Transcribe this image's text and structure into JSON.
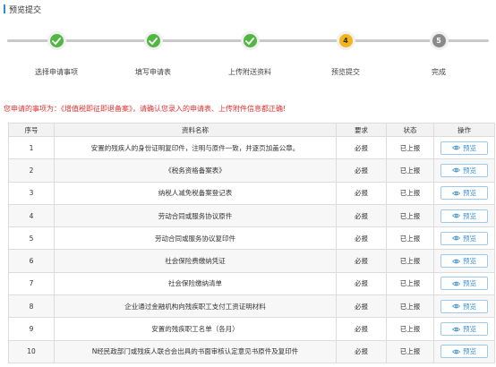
{
  "page_title": "预览提交",
  "steps": [
    {
      "label": "选择申请事项",
      "state": "done",
      "mark": ""
    },
    {
      "label": "填写申请表",
      "state": "done",
      "mark": ""
    },
    {
      "label": "上传附送资料",
      "state": "done",
      "mark": ""
    },
    {
      "label": "预览提交",
      "state": "current",
      "mark": "4"
    },
    {
      "label": "完成",
      "state": "todo",
      "mark": "5"
    }
  ],
  "notice": "您申请的事项为：《增值税即征即退备案》，请确认您录入的申请表、上传附件信息都正确!",
  "table": {
    "headers": {
      "seq": "序号",
      "name": "资料名称",
      "req": "要求",
      "status": "状态",
      "op": "操作"
    },
    "rows": [
      {
        "seq": "1",
        "name": "安置的残疾人的身份证明复印件，注明与原件一致，并逐页加盖公章。",
        "req": "必报",
        "status": "已上报",
        "op": "预览"
      },
      {
        "seq": "2",
        "name": "《税务资格备案表》",
        "req": "必报",
        "status": "已上报",
        "op": "预览"
      },
      {
        "seq": "3",
        "name": "纳税人减免税备案登记表",
        "req": "必报",
        "status": "已上报",
        "op": "预览"
      },
      {
        "seq": "4",
        "name": "劳动合同或服务协议原件",
        "req": "必报",
        "status": "已上报",
        "op": "预览"
      },
      {
        "seq": "5",
        "name": "劳动合同或服务协议复印件",
        "req": "必报",
        "status": "已上报",
        "op": "预览"
      },
      {
        "seq": "6",
        "name": "社会保险费缴纳凭证",
        "req": "必报",
        "status": "已上报",
        "op": "预览"
      },
      {
        "seq": "7",
        "name": "社会保险缴纳清单",
        "req": "必报",
        "status": "已上报",
        "op": "预览"
      },
      {
        "seq": "8",
        "name": "企业通过金融机构向残疾职工支付工资证明材料",
        "req": "必报",
        "status": "已上报",
        "op": "预览"
      },
      {
        "seq": "9",
        "name": "安置的残疾职工名单（各月）",
        "req": "必报",
        "status": "已上报",
        "op": "预览"
      },
      {
        "seq": "10",
        "name": "N经民政部门或残疾人联合会出具的书面审核认定意见书原件及复印件",
        "req": "必报",
        "status": "已上报",
        "op": "预览"
      }
    ]
  },
  "colors": {
    "accent": "#2b8fd6",
    "done": "#52b643",
    "current": "#f4b41a",
    "todo": "#8a8a8a",
    "notice": "#e03131"
  },
  "icons": {
    "done_step": "check-icon",
    "preview": "eye-icon"
  }
}
